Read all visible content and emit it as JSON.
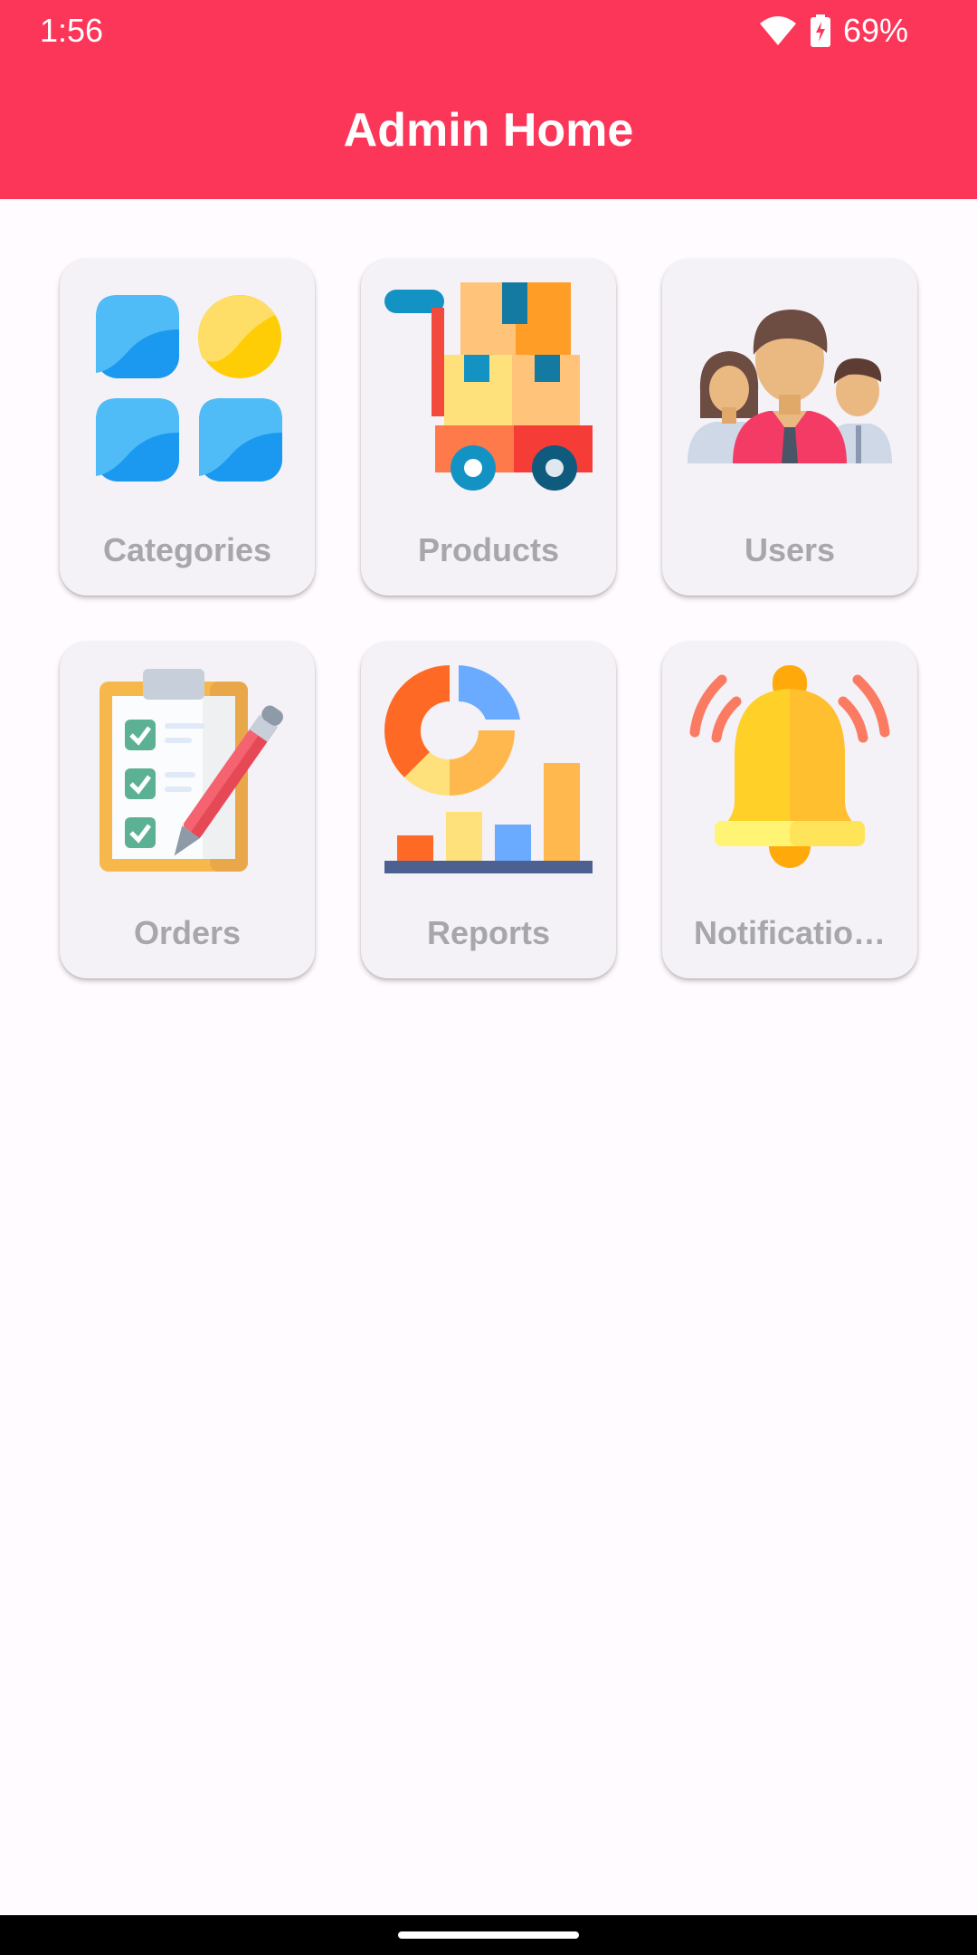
{
  "status_bar": {
    "time": "1:56",
    "battery": "69%"
  },
  "app_bar": {
    "title": "Admin Home"
  },
  "tiles": [
    {
      "label": "Categories",
      "icon": "categories-icon"
    },
    {
      "label": "Products",
      "icon": "products-cart-icon"
    },
    {
      "label": "Users",
      "icon": "users-group-icon"
    },
    {
      "label": "Orders",
      "icon": "orders-clipboard-icon"
    },
    {
      "label": "Reports",
      "icon": "reports-chart-icon"
    },
    {
      "label": "Notificatio…",
      "icon": "notification-bell-icon"
    }
  ],
  "colors": {
    "app_bar": "#fc3659",
    "card_background": "#f4f1f7",
    "label_text": "#a7a6aa",
    "page_background": "#fffbfe"
  }
}
